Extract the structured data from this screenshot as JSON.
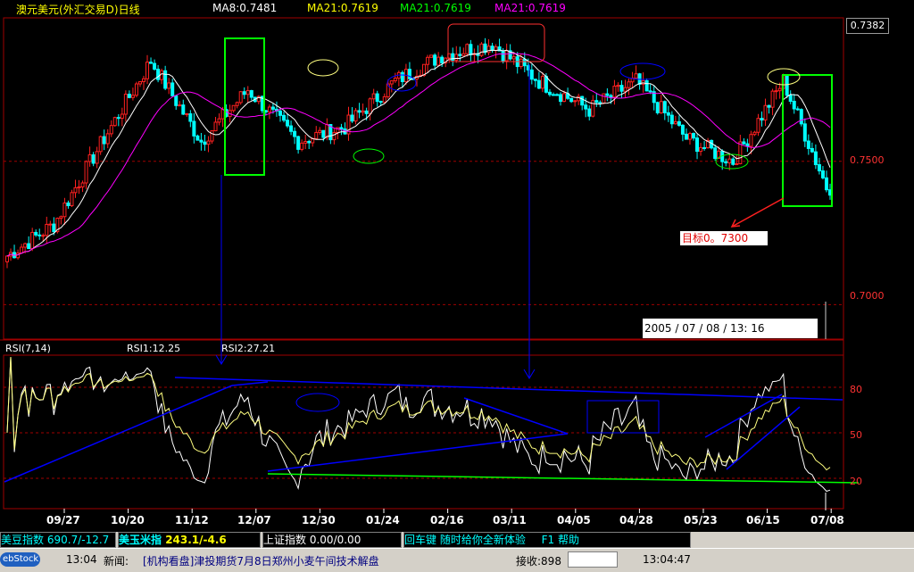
{
  "header": {
    "title": "澳元美元(外汇交易D)日线",
    "ma8": "MA8:0.7481",
    "ma21a": "MA21:0.7619",
    "ma21b": "MA21:0.7619",
    "ma21c": "MA21:0.7619"
  },
  "price_axis": {
    "current": "0.7382",
    "labels": [
      "0.7500",
      "0.7000"
    ]
  },
  "rsi": {
    "title": "RSI(7,14)",
    "rsi1": "RSI1:12.25",
    "rsi2": "RSI2:27.21",
    "levels": [
      "80",
      "50",
      "20"
    ]
  },
  "annotations": {
    "target": "目标0。7300",
    "timestamp": "2005 / 07 / 08 / 13:  16"
  },
  "chart_data": {
    "type": "candlestick",
    "title": "澳元美元(外汇交易D)日线",
    "x_tick_labels": [
      "09/27",
      "10/20",
      "11/12",
      "12/07",
      "12/30",
      "01/24",
      "02/16",
      "03/11",
      "04/05",
      "04/28",
      "05/23",
      "06/15",
      "07/08"
    ],
    "y_tick_labels": [
      "0.7500",
      "0.7000"
    ],
    "last_price": 0.7382,
    "close_anchors": [
      {
        "x": "09/27",
        "close": 0.717
      },
      {
        "x": "10/20",
        "close": 0.728
      },
      {
        "x": "11/12",
        "close": 0.758
      },
      {
        "x": "11/24",
        "close": 0.785
      },
      {
        "x": "12/07",
        "close": 0.757
      },
      {
        "x": "12/30",
        "close": 0.775
      },
      {
        "x": "01/10",
        "close": 0.757
      },
      {
        "x": "01/24",
        "close": 0.762
      },
      {
        "x": "02/03",
        "close": 0.778
      },
      {
        "x": "02/16",
        "close": 0.787
      },
      {
        "x": "03/11",
        "close": 0.791
      },
      {
        "x": "03/22",
        "close": 0.778
      },
      {
        "x": "04/05",
        "close": 0.768
      },
      {
        "x": "04/28",
        "close": 0.778
      },
      {
        "x": "05/12",
        "close": 0.758
      },
      {
        "x": "05/23",
        "close": 0.75
      },
      {
        "x": "06/15",
        "close": 0.778
      },
      {
        "x": "07/08",
        "close": 0.738
      }
    ],
    "ylim": [
      0.688,
      0.8
    ],
    "series": [
      {
        "name": "MA8",
        "value": 0.7481,
        "color": "#ffffff"
      },
      {
        "name": "MA21",
        "value": 0.7619,
        "color": "#ff00ff"
      }
    ],
    "rsi_series": [
      {
        "name": "RSI1",
        "last": 12.25,
        "color": "#ffffff"
      },
      {
        "name": "RSI2",
        "last": 27.21,
        "color": "#ffff80"
      }
    ],
    "rsi_levels": [
      80,
      50,
      20
    ],
    "target_label": "目标0。7300",
    "colors": {
      "up": "#ff2020",
      "down": "#00ffff",
      "grid": "#a00000"
    }
  },
  "status_bar": {
    "index1_label": "美豆指数",
    "index1_value": "690.7/-12.7",
    "index2_label": "美玉米指",
    "index2_value": "243.1/-4.6",
    "index3_label": "上证指数",
    "index3_value": "0.00/0.00",
    "ticker": "回车键  随时给你全新体验",
    "help": "F1  帮助"
  },
  "news_bar": {
    "logo": "ebStock",
    "time": "13:04",
    "label": "新闻:",
    "headline": "[机构看盘]津投期货7月8日郑州小麦午间技术解盘",
    "recv_label": "接收:898",
    "clock": "13:04:47"
  }
}
